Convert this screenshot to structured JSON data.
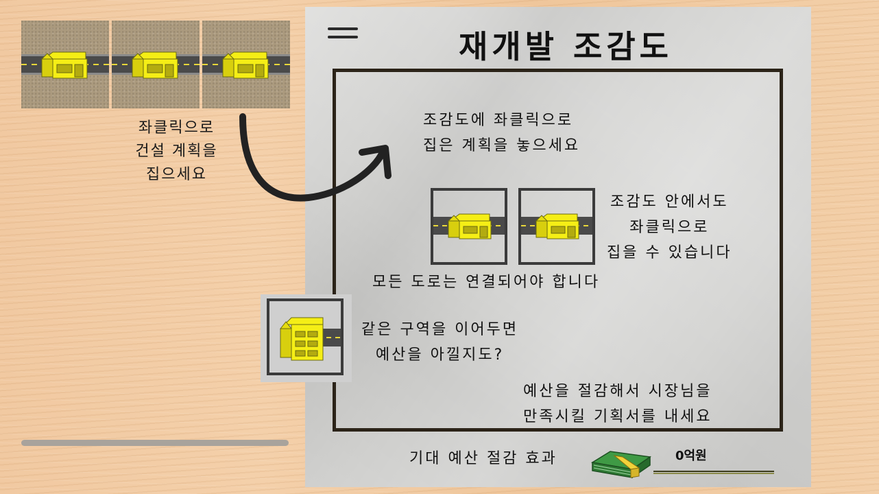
{
  "palette": {
    "house_yellow": "#f5ee16",
    "road": "#4a4a4a",
    "road_line": "#e8d83a",
    "ground": "#ab9a7e",
    "paper": "#d3d3d1",
    "frame": "#2b2318",
    "money_green": "#2f7a34"
  },
  "left_panel": {
    "build_options": [
      {
        "icon": "house-road-icon",
        "label": ""
      },
      {
        "icon": "house-road-icon",
        "label": ""
      },
      {
        "icon": "house-road-icon",
        "label": ""
      }
    ],
    "instruction_lines": [
      "좌클릭으로",
      "건설 계획을",
      "집으세요"
    ],
    "arrow_icon": "curved-arrow-icon",
    "progress": 0
  },
  "plan": {
    "menu_icon": "menu-icon",
    "title": "재개발 조감도",
    "tip_place": [
      "조감도에 좌클릭으로",
      "집은 계획을 놓으세요"
    ],
    "tip_pickup": [
      "조감도 안에서도",
      "좌클릭으로",
      "집을 수 있습니다"
    ],
    "tip_roads": "모든 도로는 연결되어야 합니다",
    "tip_connect": [
      "같은 구역을 이어두면",
      "예산을 아낄지도?"
    ],
    "tip_goal": [
      "예산을 절감해서 시장님을",
      "만족시킬 기획서를 내세요"
    ],
    "savings_label": "기대 예산 절감 효과",
    "savings_value": "0억원",
    "money_icon": "money-stack-icon"
  }
}
